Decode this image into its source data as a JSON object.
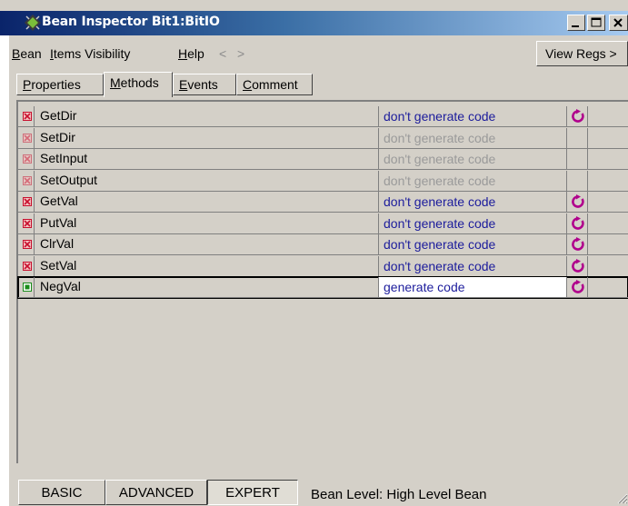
{
  "window": {
    "title": "Bean Inspector Bit1:BitIO",
    "title_icon": "bean-cpu-icon",
    "controls": [
      "minimize-icon",
      "maximize-icon",
      "close-icon"
    ]
  },
  "menu": {
    "items": [
      {
        "label": "Bean",
        "underline": "B",
        "rest": "ean"
      },
      {
        "label": "Items Visibility",
        "underline": "I",
        "rest": "tems Visibility"
      },
      {
        "label": "Help",
        "underline": "H",
        "rest": "elp"
      }
    ],
    "nav_back": "<",
    "nav_forward": ">",
    "view_regs": "View Regs >"
  },
  "tabs": [
    {
      "label": "Properties",
      "u": "P",
      "rest": "roperties",
      "active": false
    },
    {
      "label": "Methods",
      "u": "M",
      "rest": "ethods",
      "active": true
    },
    {
      "label": "Events",
      "u": "E",
      "rest": "vents",
      "active": false
    },
    {
      "label": "Comment",
      "u": "C",
      "rest": "omment",
      "active": false
    }
  ],
  "methods": [
    {
      "name": "GetDir",
      "value": "don't generate code",
      "enabled": true,
      "has_refresh": true,
      "state": "off"
    },
    {
      "name": "SetDir",
      "value": "don't generate code",
      "enabled": false,
      "has_refresh": false,
      "state": "off-disabled"
    },
    {
      "name": "SetInput",
      "value": "don't generate code",
      "enabled": false,
      "has_refresh": false,
      "state": "off-disabled"
    },
    {
      "name": "SetOutput",
      "value": "don't generate code",
      "enabled": false,
      "has_refresh": false,
      "state": "off-disabled"
    },
    {
      "name": "GetVal",
      "value": "don't generate code",
      "enabled": true,
      "has_refresh": true,
      "state": "off"
    },
    {
      "name": "PutVal",
      "value": "don't generate code",
      "enabled": true,
      "has_refresh": true,
      "state": "off"
    },
    {
      "name": "ClrVal",
      "value": "don't generate code",
      "enabled": true,
      "has_refresh": true,
      "state": "off"
    },
    {
      "name": "SetVal",
      "value": "don't generate code",
      "enabled": true,
      "has_refresh": true,
      "state": "off"
    },
    {
      "name": "NegVal",
      "value": "generate code",
      "enabled": true,
      "has_refresh": true,
      "state": "on",
      "selected": true
    }
  ],
  "bottom": {
    "basic": "BASIC",
    "advanced": "ADVANCED",
    "expert": "EXPERT",
    "status": "Bean Level: High Level Bean"
  },
  "colors": {
    "title_start": "#0a246a",
    "title_end": "#a6caf0",
    "value_text": "#1c1c9c",
    "disabled_text": "#9a9a9a",
    "icon_off": "#c8102e",
    "icon_on": "#1a8c1a",
    "refresh": "#b0008c"
  }
}
